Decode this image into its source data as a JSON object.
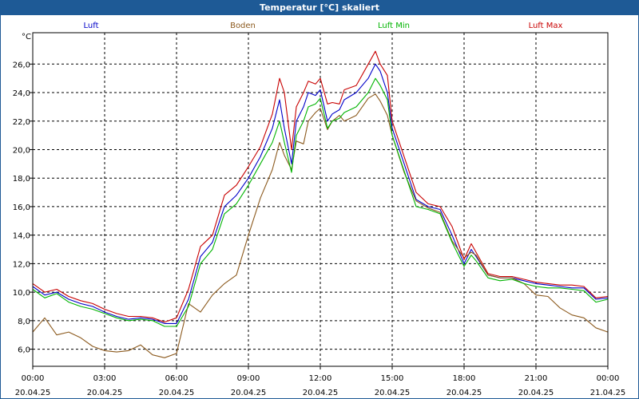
{
  "window": {
    "title": "Temperatur [°C] skaliert"
  },
  "chart_data": {
    "type": "line",
    "title": "Temperatur [°C] skaliert",
    "ylabel": "°C",
    "xlabel": "",
    "grid": true,
    "legend_position": "top",
    "ylim": [
      4.8,
      28.2
    ],
    "xlim": [
      0,
      24
    ],
    "yticks": [
      "6,0",
      "8,0",
      "10,0",
      "12,0",
      "14,0",
      "16,0",
      "18,0",
      "20,0",
      "22,0",
      "24,0",
      "26,0"
    ],
    "xticks": [
      {
        "time": "00:00",
        "date": "20.04.25"
      },
      {
        "time": "03:00",
        "date": "20.04.25"
      },
      {
        "time": "06:00",
        "date": "20.04.25"
      },
      {
        "time": "09:00",
        "date": "20.04.25"
      },
      {
        "time": "12:00",
        "date": "20.04.25"
      },
      {
        "time": "15:00",
        "date": "20.04.25"
      },
      {
        "time": "18:00",
        "date": "20.04.25"
      },
      {
        "time": "21:00",
        "date": "20.04.25"
      },
      {
        "time": "00:00",
        "date": "21.04.25"
      }
    ],
    "x": [
      0,
      0.5,
      1,
      1.5,
      2,
      2.5,
      3,
      3.5,
      4,
      4.5,
      5,
      5.5,
      6,
      6.5,
      7,
      7.5,
      8,
      8.5,
      9,
      9.5,
      10,
      10.3,
      10.5,
      10.8,
      11,
      11.3,
      11.5,
      11.8,
      12,
      12.3,
      12.5,
      12.8,
      13,
      13.5,
      14,
      14.3,
      14.5,
      14.8,
      15,
      15.5,
      16,
      16.5,
      17,
      17.5,
      18,
      18.3,
      18.5,
      19,
      19.5,
      20,
      20.5,
      21,
      21.5,
      22,
      22.5,
      23,
      23.5,
      24
    ],
    "series": [
      {
        "name": "Luft",
        "color": "#0000c8",
        "values": [
          10.4,
          9.8,
          10.0,
          9.5,
          9.2,
          9.0,
          8.6,
          8.3,
          8.1,
          8.2,
          8.1,
          7.8,
          7.8,
          9.5,
          12.5,
          13.5,
          16.0,
          16.8,
          18.0,
          19.5,
          21.5,
          23.5,
          21.5,
          19.0,
          22.0,
          23.0,
          24.0,
          23.8,
          24.2,
          22.0,
          22.5,
          22.8,
          23.5,
          24.0,
          25.0,
          26.0,
          25.5,
          24.0,
          21.5,
          19.0,
          16.5,
          16.0,
          15.8,
          14.0,
          12.0,
          13.0,
          12.5,
          11.2,
          11.0,
          11.0,
          10.8,
          10.6,
          10.5,
          10.4,
          10.3,
          10.3,
          9.5,
          9.6
        ]
      },
      {
        "name": "Boden",
        "color": "#8c5a1e",
        "values": [
          7.2,
          8.2,
          7.0,
          7.2,
          6.8,
          6.2,
          5.9,
          5.8,
          5.9,
          6.3,
          5.6,
          5.4,
          5.7,
          9.2,
          8.6,
          9.8,
          10.6,
          11.2,
          14.0,
          16.6,
          18.6,
          20.5,
          19.6,
          18.6,
          20.6,
          20.4,
          22.0,
          22.6,
          22.9,
          21.4,
          22.0,
          22.4,
          22.0,
          22.4,
          23.6,
          23.9,
          23.4,
          22.4,
          21.0,
          18.4,
          16.4,
          15.9,
          15.6,
          13.6,
          12.4,
          12.8,
          12.6,
          11.2,
          11.0,
          11.0,
          10.6,
          9.8,
          9.7,
          8.9,
          8.4,
          8.2,
          7.5,
          7.2
        ]
      },
      {
        "name": "Luft Min",
        "color": "#00b400",
        "values": [
          10.2,
          9.6,
          9.9,
          9.3,
          9.0,
          8.8,
          8.5,
          8.2,
          8.0,
          8.1,
          8.0,
          7.6,
          7.6,
          9.0,
          12.0,
          13.0,
          15.5,
          16.2,
          17.5,
          19.0,
          20.5,
          22.0,
          20.5,
          18.4,
          21.0,
          22.0,
          23.0,
          23.2,
          23.6,
          21.5,
          22.0,
          22.2,
          22.6,
          23.0,
          24.0,
          25.0,
          24.5,
          23.5,
          21.0,
          18.5,
          16.0,
          15.8,
          15.5,
          13.5,
          11.8,
          12.6,
          12.2,
          11.0,
          10.8,
          10.9,
          10.6,
          10.4,
          10.3,
          10.3,
          10.2,
          10.1,
          9.3,
          9.5
        ]
      },
      {
        "name": "Luft Max",
        "color": "#c80000",
        "values": [
          10.6,
          10.0,
          10.2,
          9.7,
          9.4,
          9.2,
          8.8,
          8.5,
          8.3,
          8.3,
          8.2,
          7.9,
          8.2,
          10.2,
          13.2,
          14.0,
          16.8,
          17.5,
          18.8,
          20.2,
          22.5,
          25.0,
          24.0,
          20.0,
          23.0,
          24.0,
          24.8,
          24.6,
          25.0,
          23.2,
          23.3,
          23.2,
          24.2,
          24.5,
          26.0,
          26.9,
          26.0,
          25.2,
          22.0,
          19.5,
          17.0,
          16.2,
          16.0,
          14.6,
          12.3,
          13.4,
          12.8,
          11.3,
          11.1,
          11.1,
          10.9,
          10.7,
          10.6,
          10.5,
          10.5,
          10.4,
          9.6,
          9.7
        ]
      }
    ]
  }
}
